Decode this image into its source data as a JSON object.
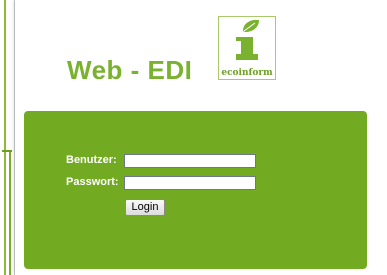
{
  "header": {
    "title": "Web - EDI",
    "logo": {
      "text": "ecoinform",
      "icon": "leaf-i-logo-icon"
    }
  },
  "login_form": {
    "username_label": "Benutzer:",
    "username_value": "",
    "password_label": "Passwort:",
    "password_value": "",
    "submit_label": "Login"
  },
  "colors": {
    "brand_green": "#72aa22",
    "title_green": "#7ab22f"
  }
}
